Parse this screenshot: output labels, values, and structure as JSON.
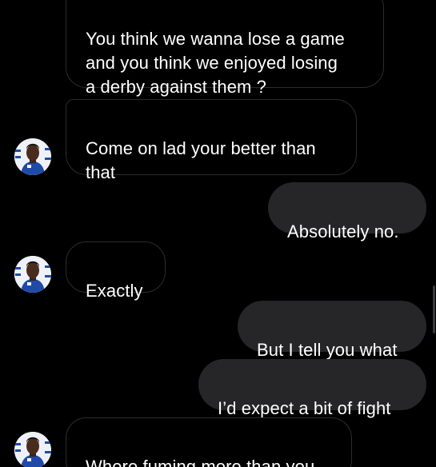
{
  "conversation": {
    "messages": [
      {
        "direction": "incoming",
        "show_avatar": false,
        "text": "You think we wanna lose a game\nand you think we enjoyed losing\na derby against them ?"
      },
      {
        "direction": "incoming",
        "show_avatar": true,
        "text": "Come on lad your better than\nthat"
      },
      {
        "direction": "outgoing",
        "text": "Absolutely no."
      },
      {
        "direction": "incoming",
        "show_avatar": true,
        "text": "Exactly"
      },
      {
        "direction": "outgoing",
        "text": "But I tell you what"
      },
      {
        "direction": "outgoing",
        "text": "I’d expect a bit of fight"
      },
      {
        "direction": "incoming",
        "show_avatar": true,
        "text": "Where fuming more than you"
      }
    ]
  },
  "theme": {
    "background": "#000000",
    "incoming_bubble_border": "#2c2c2e",
    "outgoing_bubble": "#262628",
    "text": "#ffffff",
    "avatar_shirt": "#1f4aa8"
  },
  "icons": {
    "avatar": "contact-profile-photo"
  }
}
